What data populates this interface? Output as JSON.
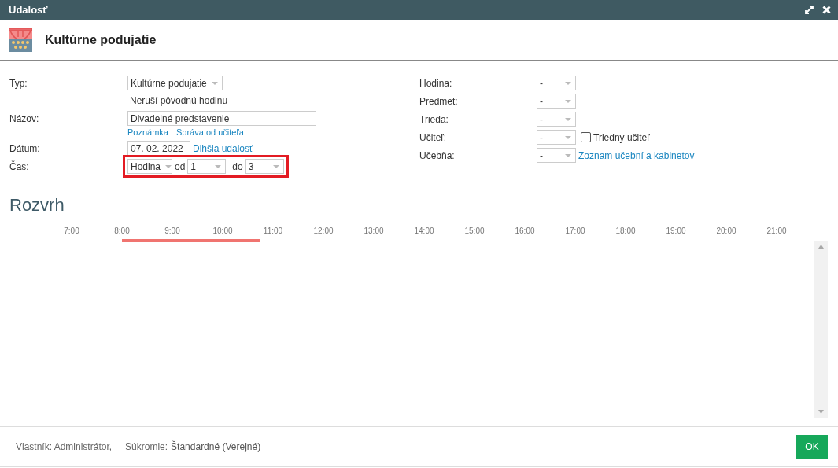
{
  "window": {
    "title": "Udalosť"
  },
  "header": {
    "title": "Kultúrne podujatie"
  },
  "type": {
    "label": "Typ:",
    "value": "Kultúrne podujatie",
    "link": "Neruší pôvodnú hodinu"
  },
  "name": {
    "label": "Názov:",
    "value": "Divadelné predstavenie",
    "links": [
      "Poznámka",
      "Správa od učiteľa"
    ]
  },
  "date": {
    "label": "Dátum:",
    "value": "07. 02. 2022",
    "link": "Dlhšia udalosť"
  },
  "time": {
    "label": "Čas:",
    "highlighted": true,
    "mode": "Hodina",
    "from_label": "od",
    "from": "1",
    "to_label": "do",
    "to": "3"
  },
  "right_fields": [
    {
      "label": "Hodina:",
      "value": "-"
    },
    {
      "label": "Predmet:",
      "value": "-"
    },
    {
      "label": "Trieda:",
      "value": "-"
    },
    {
      "label": "Učiteľ:",
      "value": "-",
      "checkbox": {
        "label": "Triedny učiteľ",
        "checked": false
      }
    },
    {
      "label": "Učebňa:",
      "value": "-",
      "link": "Zoznam učební a kabinetov"
    }
  ],
  "schedule": {
    "title": "Rozvrh",
    "hours": [
      "7:00",
      "8:00",
      "9:00",
      "10:00",
      "11:00",
      "12:00",
      "13:00",
      "14:00",
      "15:00",
      "16:00",
      "17:00",
      "18:00",
      "19:00",
      "20:00",
      "21:00"
    ],
    "event": {
      "level": 0.268
    }
  },
  "footer": {
    "owner": "Vlastník: Administrátor,",
    "privacy_label": "Súkromie:",
    "privacy_value": "Štandardné (Verejné)",
    "ok": "OK"
  }
}
